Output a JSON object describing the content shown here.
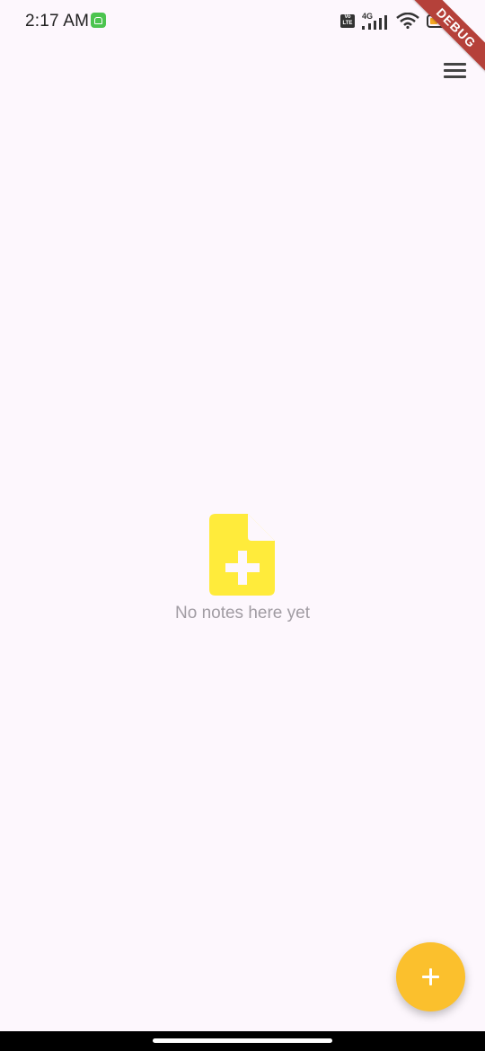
{
  "status_bar": {
    "time": "2:17 AM",
    "network_label": "4G",
    "volte_label": "Vo LTE",
    "battery_color": "#f5a623",
    "battery_level": 0.3
  },
  "debug_banner": {
    "label": "DEBUG",
    "color": "#b5413a"
  },
  "toolbar": {
    "menu_icon": "menu-icon"
  },
  "empty_state": {
    "icon": "note-add-icon",
    "icon_color": "#ffeb3b",
    "message": "No notes here yet"
  },
  "fab": {
    "icon": "plus-icon",
    "color": "#fbc02d"
  },
  "colors": {
    "background": "#fdf7fd",
    "muted_text": "#a19ca3"
  }
}
